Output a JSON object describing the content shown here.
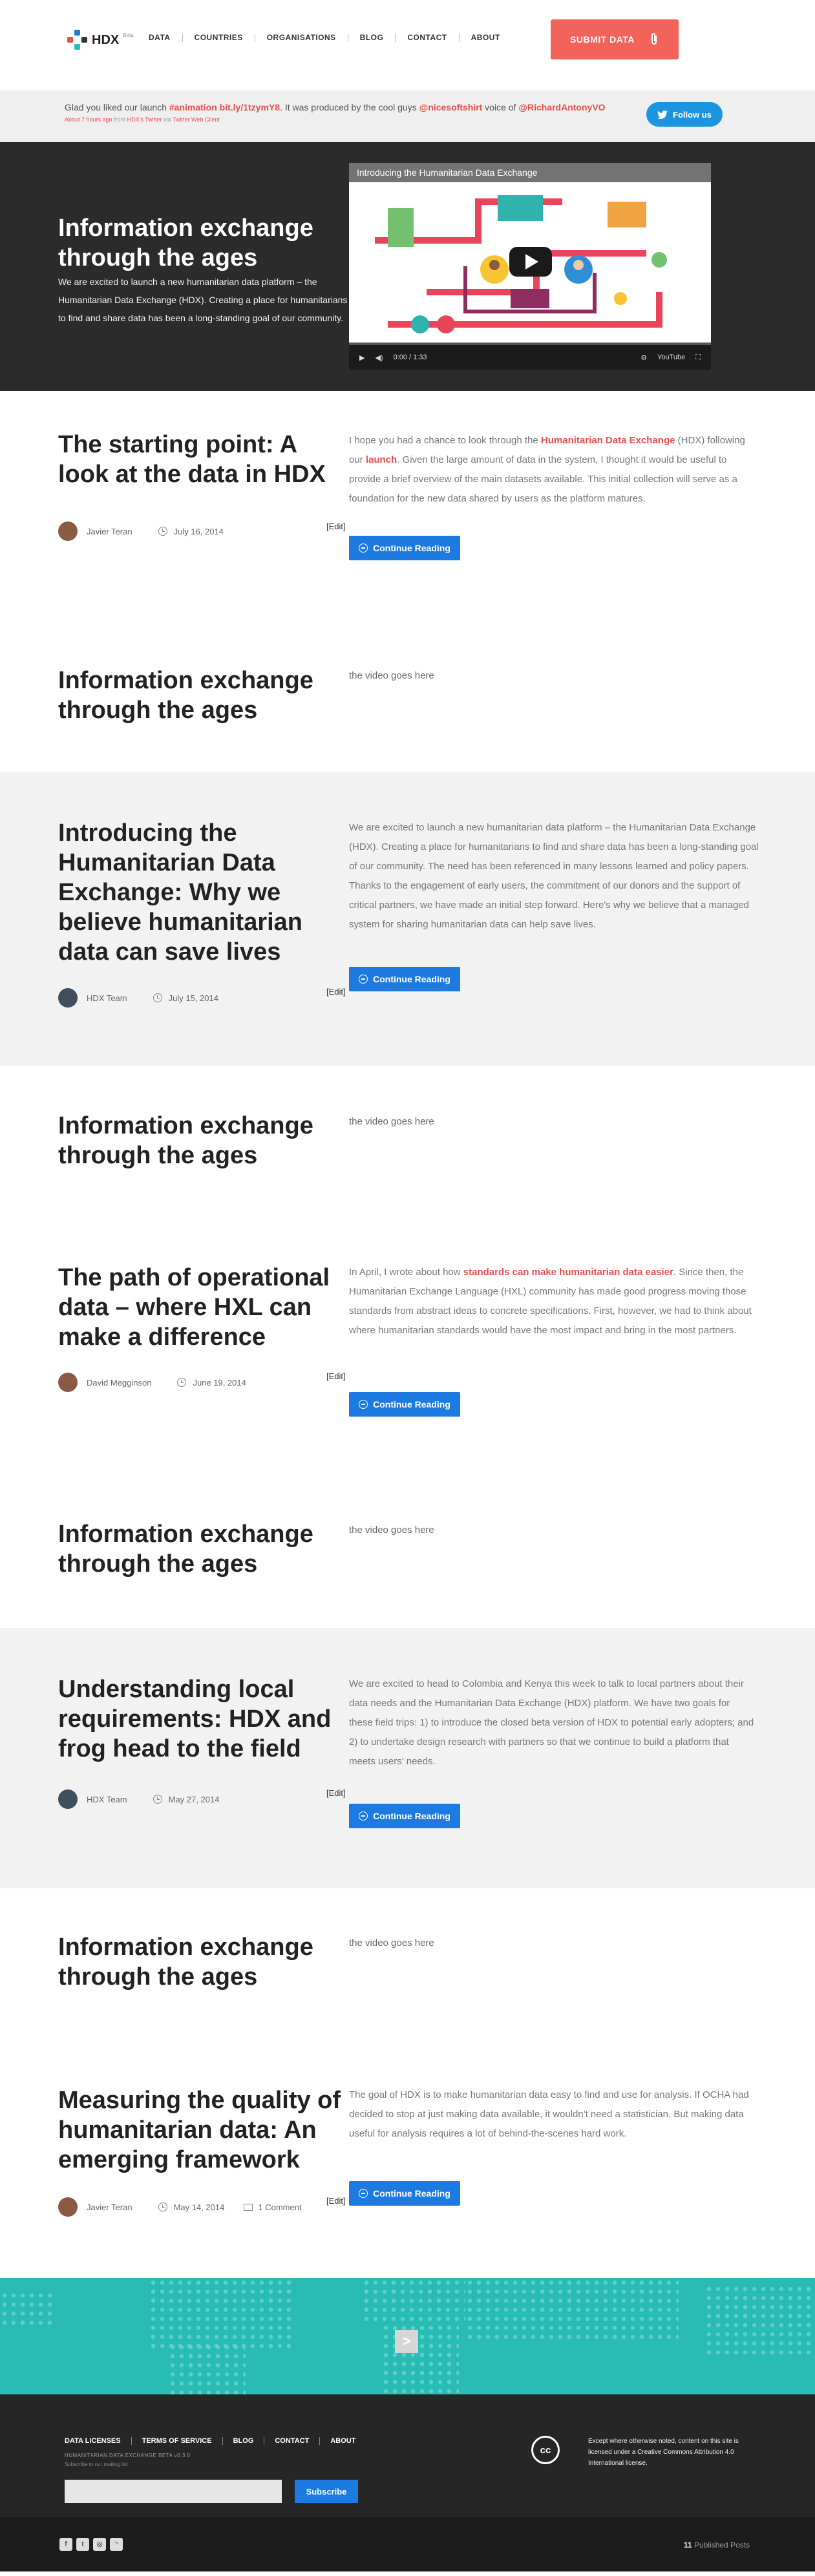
{
  "header": {
    "logo_text": "HDX",
    "logo_badge": "Beta",
    "nav": [
      "DATA",
      "COUNTRIES",
      "ORGANISATIONS",
      "BLOG",
      "CONTACT",
      "ABOUT"
    ],
    "submit_label": "SUBMIT DATA"
  },
  "twitter": {
    "text_pre": "Glad you liked our launch ",
    "hashtag": "#animation bit.ly/1tzymY8",
    "text_mid": ". It was produced by the cool guys ",
    "handle1": "@nicesoftshirt",
    "text_mid2": " voice of ",
    "handle2": "@RichardAntonyVO",
    "meta_time": "About 7 hours ago",
    "meta_from": " from ",
    "meta_source": "HDX's Twitter",
    "meta_via": " via ",
    "meta_client": "Twitter Web Client",
    "follow_label": "Follow us"
  },
  "hero": {
    "title": "Information exchange through the ages",
    "text": "We are excited to launch a new humanitarian data platform – the Humanitarian Data Exchange (HDX). Creating a place for humanitarians to find and share data has been a long-standing goal of our community.",
    "video_title": "Introducing the Humanitarian Data Exchange",
    "video_time": "0:00 / 1:33"
  },
  "posts": [
    {
      "title": "The starting point: A look at the data in HDX",
      "excerpt_pre": "I hope you had a chance to look through the ",
      "link1": "Humanitarian Data Exchange",
      "excerpt_mid": " (HDX) following our ",
      "link2": "launch",
      "excerpt_post": ". Given the large amount of data in the system, I thought it would be useful to provide a brief overview of the main datasets available. This initial collection will serve as a foundation for the new data shared by users as the platform matures.",
      "author": "Javier Teran",
      "date": "July 16, 2014",
      "edit": "[Edit]",
      "cta": "Continue Reading"
    },
    {
      "title": "Introducing the Humanitarian Data Exchange: Why we believe humanitarian data can save lives",
      "excerpt": "We are excited to launch a new humanitarian data platform – the Humanitarian Data Exchange (HDX). Creating a place for humanitarians to find and share data has been a long-standing goal of our community. The need has been referenced in many lessons learned and policy papers. Thanks to the engagement of early users, the commitment of our donors and the support of critical partners, we have made an initial step forward. Here's why we believe that a managed system for sharing humanitarian data can help save lives.",
      "author": "HDX Team",
      "date": "July 15, 2014",
      "edit": "[Edit]",
      "cta": "Continue Reading"
    },
    {
      "title": "The path of operational data – where HXL can make a difference",
      "excerpt_pre": "In April, I wrote about how ",
      "link1": "standards can make humanitarian data easier",
      "excerpt_post": ". Since then, the Humanitarian Exchange Language (HXL) community has made good progress moving those standards from abstract ideas to concrete specifications. First, however, we had to think about where humanitarian standards would have the most impact and bring in the most partners.",
      "author": "David Megginson",
      "date": "June 19, 2014",
      "edit": "[Edit]",
      "cta": "Continue Reading"
    },
    {
      "title": "Understanding local requirements: HDX and frog head to the field",
      "excerpt": "We are excited to head to Colombia and Kenya this week to talk to local partners about their data needs and the Humanitarian Data Exchange (HDX) platform. We have two goals for these field trips: 1) to introduce the closed beta version of HDX to potential early adopters; and 2) to undertake design research with partners so that we continue to build a platform that meets users' needs.",
      "author": "HDX Team",
      "date": "May 27, 2014",
      "edit": "[Edit]",
      "cta": "Continue Reading"
    },
    {
      "title": "Measuring the quality of humanitarian data: An emerging framework",
      "excerpt": "The goal of HDX is to make humanitarian data easy to find and use for analysis. If OCHA had decided to stop at just making data available, it wouldn't need a statistician. But making data useful for analysis requires a lot of behind-the-scenes hard work.",
      "author": "Javier Teran",
      "date": "May 14, 2014",
      "comments": "1 Comment",
      "edit": "[Edit]",
      "cta": "Continue Reading"
    }
  ],
  "video_blocks": {
    "title": "Information exchange through the ages",
    "placeholder": "the video goes here"
  },
  "pager_label": ">",
  "footer": {
    "nav": [
      "DATA LICENSES",
      "TERMS OF SERVICE",
      "BLOG",
      "CONTACT",
      "ABOUT"
    ],
    "version": "HUMANITARIAN DATA EXCHANGE BETA v0.3.0",
    "subscribe_text": "Subscribe to our mailing list",
    "subscribe_btn": "Subscribe",
    "cc_mark": "cc",
    "license": "Except where otherwise noted, content on this site is licensed under a Creative Commons Attribution 4.0 International license.",
    "count": "11",
    "count_label": " Published Posts"
  },
  "colors": {
    "accent": "#f2635b",
    "blue": "#1d7ae0",
    "teal": "#29bcb4",
    "dark": "#2b2b2b"
  }
}
